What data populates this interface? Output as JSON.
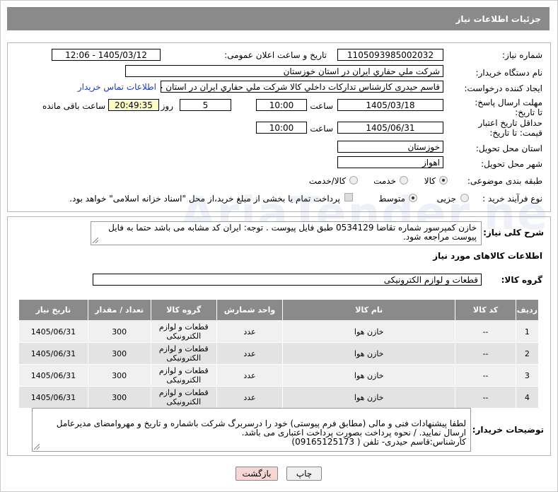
{
  "header": {
    "title": "جزئیات اطلاعات نیاز"
  },
  "form": {
    "need_number_label": "شماره نیاز:",
    "need_number": "1105093985002032",
    "announce_label": "تاریخ و ساعت اعلان عمومی:",
    "announce_value": "1405/03/12 - 12:06",
    "buyer_label": "نام دستگاه خریدار:",
    "buyer_value": "شرکت ملي حفاري ايران در استان خوزستان",
    "creator_label": "ایجاد کننده درخواست:",
    "creator_value": "قاسم حيدری کارشناس تداركات داخلي كالا شرکت ملي حفاري ايران در استان خوزستان",
    "contact_link": "اطلاعات تماس خریدار",
    "reply_deadline_label": "مهلت ارسال پاسخ: تا تاریخ:",
    "reply_date": "1405/03/18",
    "time_label": "ساعت",
    "reply_time": "10:00",
    "days_value": "5",
    "days_label": "روز و",
    "remaining_time": "20:49:35",
    "remaining_label": "ساعت باقی مانده",
    "validity_label": "حداقل تاریخ اعتبار قیمت: تا تاریخ:",
    "validity_date": "1405/06/31",
    "validity_time": "10:00",
    "province_label": "استان محل تحویل:",
    "province_value": "خوزستان",
    "city_label": "شهر محل تحویل:",
    "city_value": "اهواز",
    "category_label": "طبقه بندی موضوعی:",
    "category_options": [
      "کالا",
      "خدمت",
      "کالا/خدمت"
    ],
    "category_selected": "کالا",
    "process_label": "نوع فرآیند خرید :",
    "process_options": [
      "جزیی",
      "متوسط"
    ],
    "process_selected": "متوسط",
    "payment_note": "پرداخت تمام یا بخشی از مبلغ خرید،از محل \"اسناد خزانه اسلامی\" خواهد بود."
  },
  "description": {
    "label": "شرح کلی نیاز:",
    "text": "خازن کمپرسور شماره تقاضا 0534129 طبق فایل پیوست . توجه: ایران کد مشابه می باشد حتما به فایل پیوست مراجعه شود."
  },
  "goods": {
    "section_title": "اطلاعات کالاهای مورد نیاز",
    "group_label": "گروه کالا:",
    "group_value": "قطعات و لوازم الکترونیکی"
  },
  "table": {
    "headers": [
      "ردیف",
      "کد کالا",
      "نام کالا",
      "واحد شمارش",
      "گروه کالا",
      "تعداد / مقدار",
      "تاریخ نیاز"
    ],
    "rows": [
      [
        "1",
        "--",
        "خازن هوا",
        "عدد",
        "قطعات و لوازم الکترونیکی",
        "300",
        "1405/06/31"
      ],
      [
        "2",
        "--",
        "خازن هوا",
        "عدد",
        "قطعات و لوازم الکترونیکی",
        "300",
        "1405/06/31"
      ],
      [
        "3",
        "--",
        "خازن هوا",
        "عدد",
        "قطعات و لوازم الکترونیکی",
        "300",
        "1405/06/31"
      ],
      [
        "4",
        "--",
        "خازن هوا",
        "عدد",
        "قطعات و لوازم الکترونیکی",
        "300",
        "1405/06/31"
      ]
    ]
  },
  "buyer_notes": {
    "label": "توضیحات خریدار:",
    "text": "لطفا پیشنهادات فنی و مالی (مطابق فرم پیوستی) خود را درسربرگ شرکت باشماره و تاریخ و مهروامضای مدیرعامل ارسال نمایید. / نحوه پرداخت بصورت پرداخت اعتباری می باشد.\nکارشناس:قاسم حیدری- تلفن ( 09165125173)"
  },
  "buttons": {
    "print": "چاپ",
    "back": "بازگشت"
  },
  "colors": {
    "header_bg": "#8a8a8a",
    "yellow_field": "#fdfbc4",
    "link": "#1b3ea8",
    "back_button": "#f7d6d6",
    "print_button": "#f0f0f0"
  }
}
